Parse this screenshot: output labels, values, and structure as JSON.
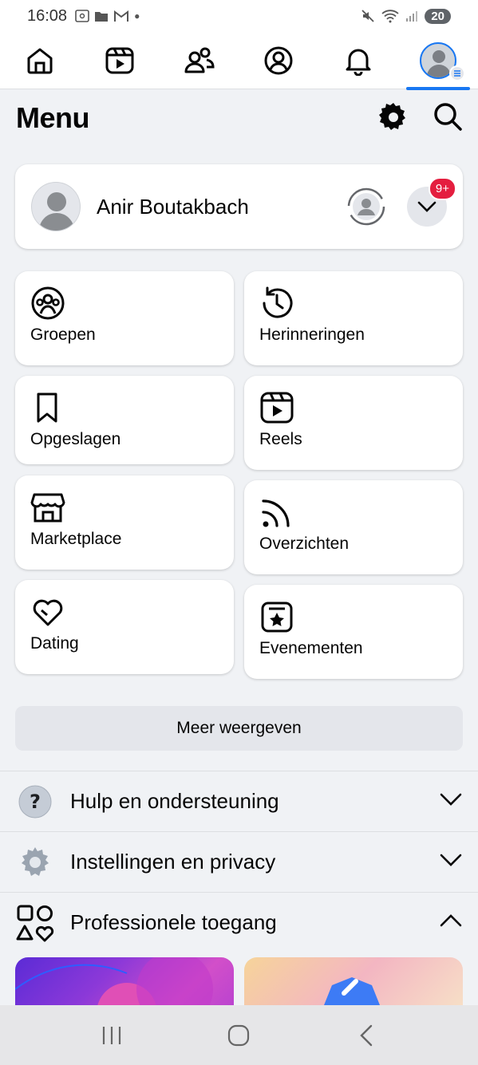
{
  "status_bar": {
    "time": "16:08",
    "battery": "20"
  },
  "nav_tabs": [
    {
      "name": "home",
      "icon": "home-icon"
    },
    {
      "name": "video",
      "icon": "video-icon"
    },
    {
      "name": "friends",
      "icon": "friends-icon"
    },
    {
      "name": "profile",
      "icon": "profile-icon"
    },
    {
      "name": "notifications",
      "icon": "bell-icon"
    },
    {
      "name": "menu",
      "icon": "menu-avatar-icon",
      "active": true
    }
  ],
  "header": {
    "title": "Menu"
  },
  "profile": {
    "name": "Anir Boutakbach",
    "notification_badge": "9+"
  },
  "shortcuts": {
    "groups": "Groepen",
    "memories": "Herinneringen",
    "saved": "Opgeslagen",
    "reels": "Reels",
    "marketplace": "Marketplace",
    "feeds": "Overzichten",
    "dating": "Dating",
    "events": "Evenementen"
  },
  "more_button": "Meer weergeven",
  "sections": {
    "help": "Hulp en ondersteuning",
    "settings": "Instellingen en privacy",
    "professional": "Professionele toegang"
  },
  "colors": {
    "accent": "#1877f2",
    "badge": "#e41e3f",
    "background": "#f0f2f5"
  }
}
